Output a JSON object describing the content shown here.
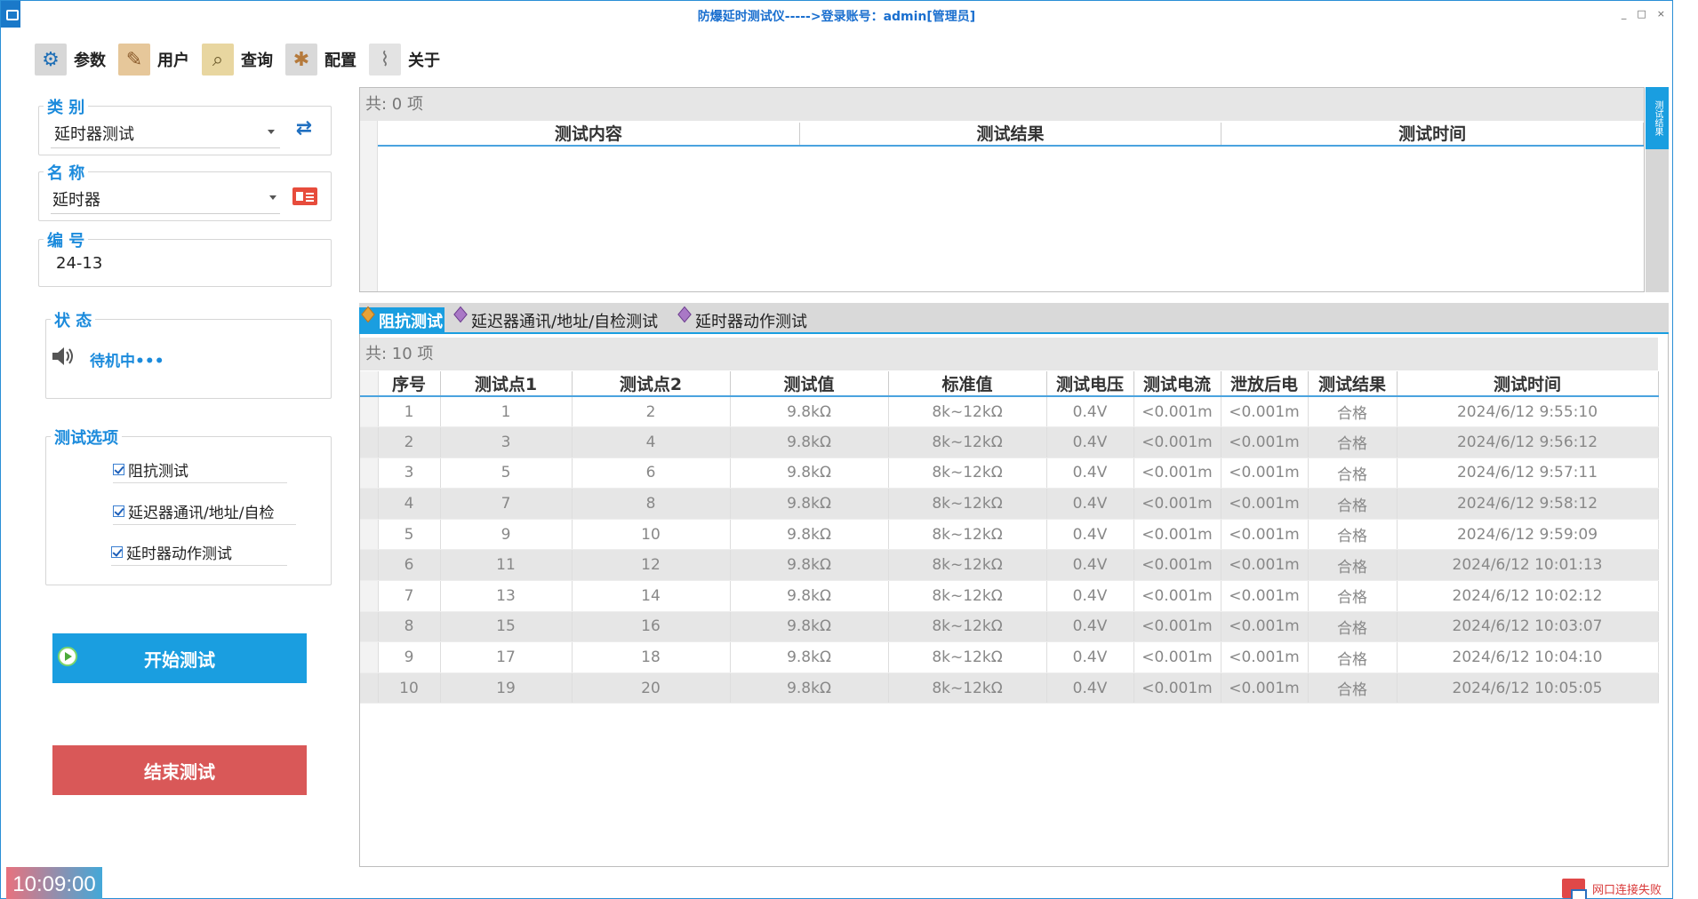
{
  "window": {
    "title": "防爆延时测试仪----->登录账号：admin[管理员]",
    "controls": [
      "_",
      "□",
      "×"
    ]
  },
  "toolbar": {
    "items": [
      {
        "label": "参数",
        "icon": "gear-icon"
      },
      {
        "label": "用户",
        "icon": "user-icon"
      },
      {
        "label": "查询",
        "icon": "search-icon"
      },
      {
        "label": "配置",
        "icon": "config-icon"
      },
      {
        "label": "关于",
        "icon": "paperclip-icon"
      }
    ]
  },
  "left": {
    "category": {
      "label": "类 别",
      "value": "延时器测试"
    },
    "name": {
      "label": "名 称",
      "value": "延时器"
    },
    "code": {
      "label": "编 号",
      "value": "24-13"
    },
    "status": {
      "label": "状 态",
      "value": "待机中•••"
    },
    "options": {
      "label": "测试选项",
      "items": [
        "阻抗测试",
        "延迟器通讯/地址/自检",
        "延时器动作测试"
      ]
    },
    "start_label": "开始测试",
    "end_label": "结束测试",
    "clock": "10:09:00"
  },
  "results": {
    "count": "共: 0 项",
    "headers": [
      "测试内容",
      "测试结果",
      "测试时间"
    ],
    "side_tab": "测试结果"
  },
  "tabs": {
    "items": [
      "阻抗测试",
      "延迟器通讯/地址/自检测试",
      "延时器动作测试"
    ],
    "active": 0
  },
  "data": {
    "count": "共: 10 项",
    "headers": [
      "序号",
      "测试点1",
      "测试点2",
      "测试值",
      "标准值",
      "测试电压",
      "测试电流",
      "泄放后电",
      "测试结果",
      "测试时间"
    ],
    "rows": [
      [
        "1",
        "1",
        "2",
        "9.8kΩ",
        "8k~12kΩ",
        "0.4V",
        "<0.001m",
        "<0.001m",
        "合格",
        "2024/6/12 9:55:10"
      ],
      [
        "2",
        "3",
        "4",
        "9.8kΩ",
        "8k~12kΩ",
        "0.4V",
        "<0.001m",
        "<0.001m",
        "合格",
        "2024/6/12 9:56:12"
      ],
      [
        "3",
        "5",
        "6",
        "9.8kΩ",
        "8k~12kΩ",
        "0.4V",
        "<0.001m",
        "<0.001m",
        "合格",
        "2024/6/12 9:57:11"
      ],
      [
        "4",
        "7",
        "8",
        "9.8kΩ",
        "8k~12kΩ",
        "0.4V",
        "<0.001m",
        "<0.001m",
        "合格",
        "2024/6/12 9:58:12"
      ],
      [
        "5",
        "9",
        "10",
        "9.8kΩ",
        "8k~12kΩ",
        "0.4V",
        "<0.001m",
        "<0.001m",
        "合格",
        "2024/6/12 9:59:09"
      ],
      [
        "6",
        "11",
        "12",
        "9.8kΩ",
        "8k~12kΩ",
        "0.4V",
        "<0.001m",
        "<0.001m",
        "合格",
        "2024/6/12 10:01:13"
      ],
      [
        "7",
        "13",
        "14",
        "9.8kΩ",
        "8k~12kΩ",
        "0.4V",
        "<0.001m",
        "<0.001m",
        "合格",
        "2024/6/12 10:02:12"
      ],
      [
        "8",
        "15",
        "16",
        "9.8kΩ",
        "8k~12kΩ",
        "0.4V",
        "<0.001m",
        "<0.001m",
        "合格",
        "2024/6/12 10:03:07"
      ],
      [
        "9",
        "17",
        "18",
        "9.8kΩ",
        "8k~12kΩ",
        "0.4V",
        "<0.001m",
        "<0.001m",
        "合格",
        "2024/6/12 10:04:10"
      ],
      [
        "10",
        "19",
        "20",
        "9.8kΩ",
        "8k~12kΩ",
        "0.4V",
        "<0.001m",
        "<0.001m",
        "合格",
        "2024/6/12 10:05:05"
      ]
    ]
  },
  "footer": {
    "network_status": "网口连接失败"
  },
  "colors": {
    "accent": "#1a9ee0",
    "danger": "#d95858",
    "label": "#1c8bdc"
  }
}
